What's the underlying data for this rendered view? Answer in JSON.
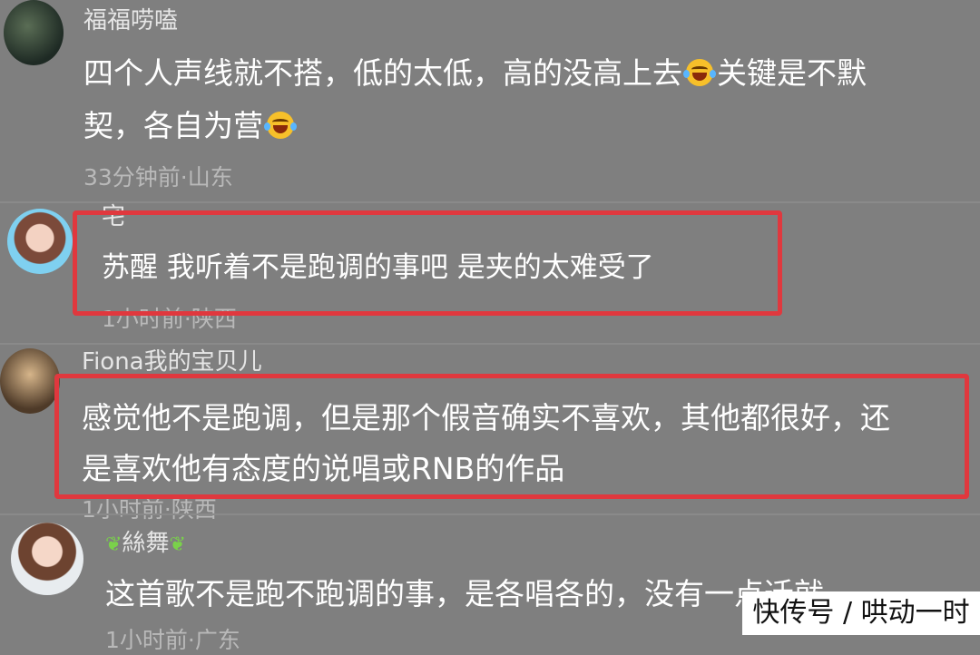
{
  "comments": [
    {
      "username": "福福唠嗑",
      "text_line1": "四个人声线就不搭，低的太低，高的没高上去",
      "text_line1b": "关键是不默",
      "text_line2": "契，各自为营",
      "meta": "33分钟前·山东",
      "emoji": "laughing-crying-emoji"
    },
    {
      "username": "宅",
      "text": "苏醒 我听着不是跑调的事吧 是夹的太难受了",
      "meta": "1小时前·陕西"
    },
    {
      "username": "Fiona我的宝贝儿",
      "text_line1": "感觉他不是跑调，但是那个假音确实不喜欢，其他都很好，还",
      "text_line2": "是喜欢他有态度的说唱或RNB的作品",
      "meta": "1小时前·陕西"
    },
    {
      "username": "絲舞",
      "text": "这首歌不是跑不跑调的事，是各唱各的，没有一点迁就",
      "meta": "1小时前·广东"
    }
  ],
  "watermark": "快传号 / 哄动一时",
  "colors": {
    "background": "#7f7f7f",
    "highlight_box": "#e0383e"
  }
}
